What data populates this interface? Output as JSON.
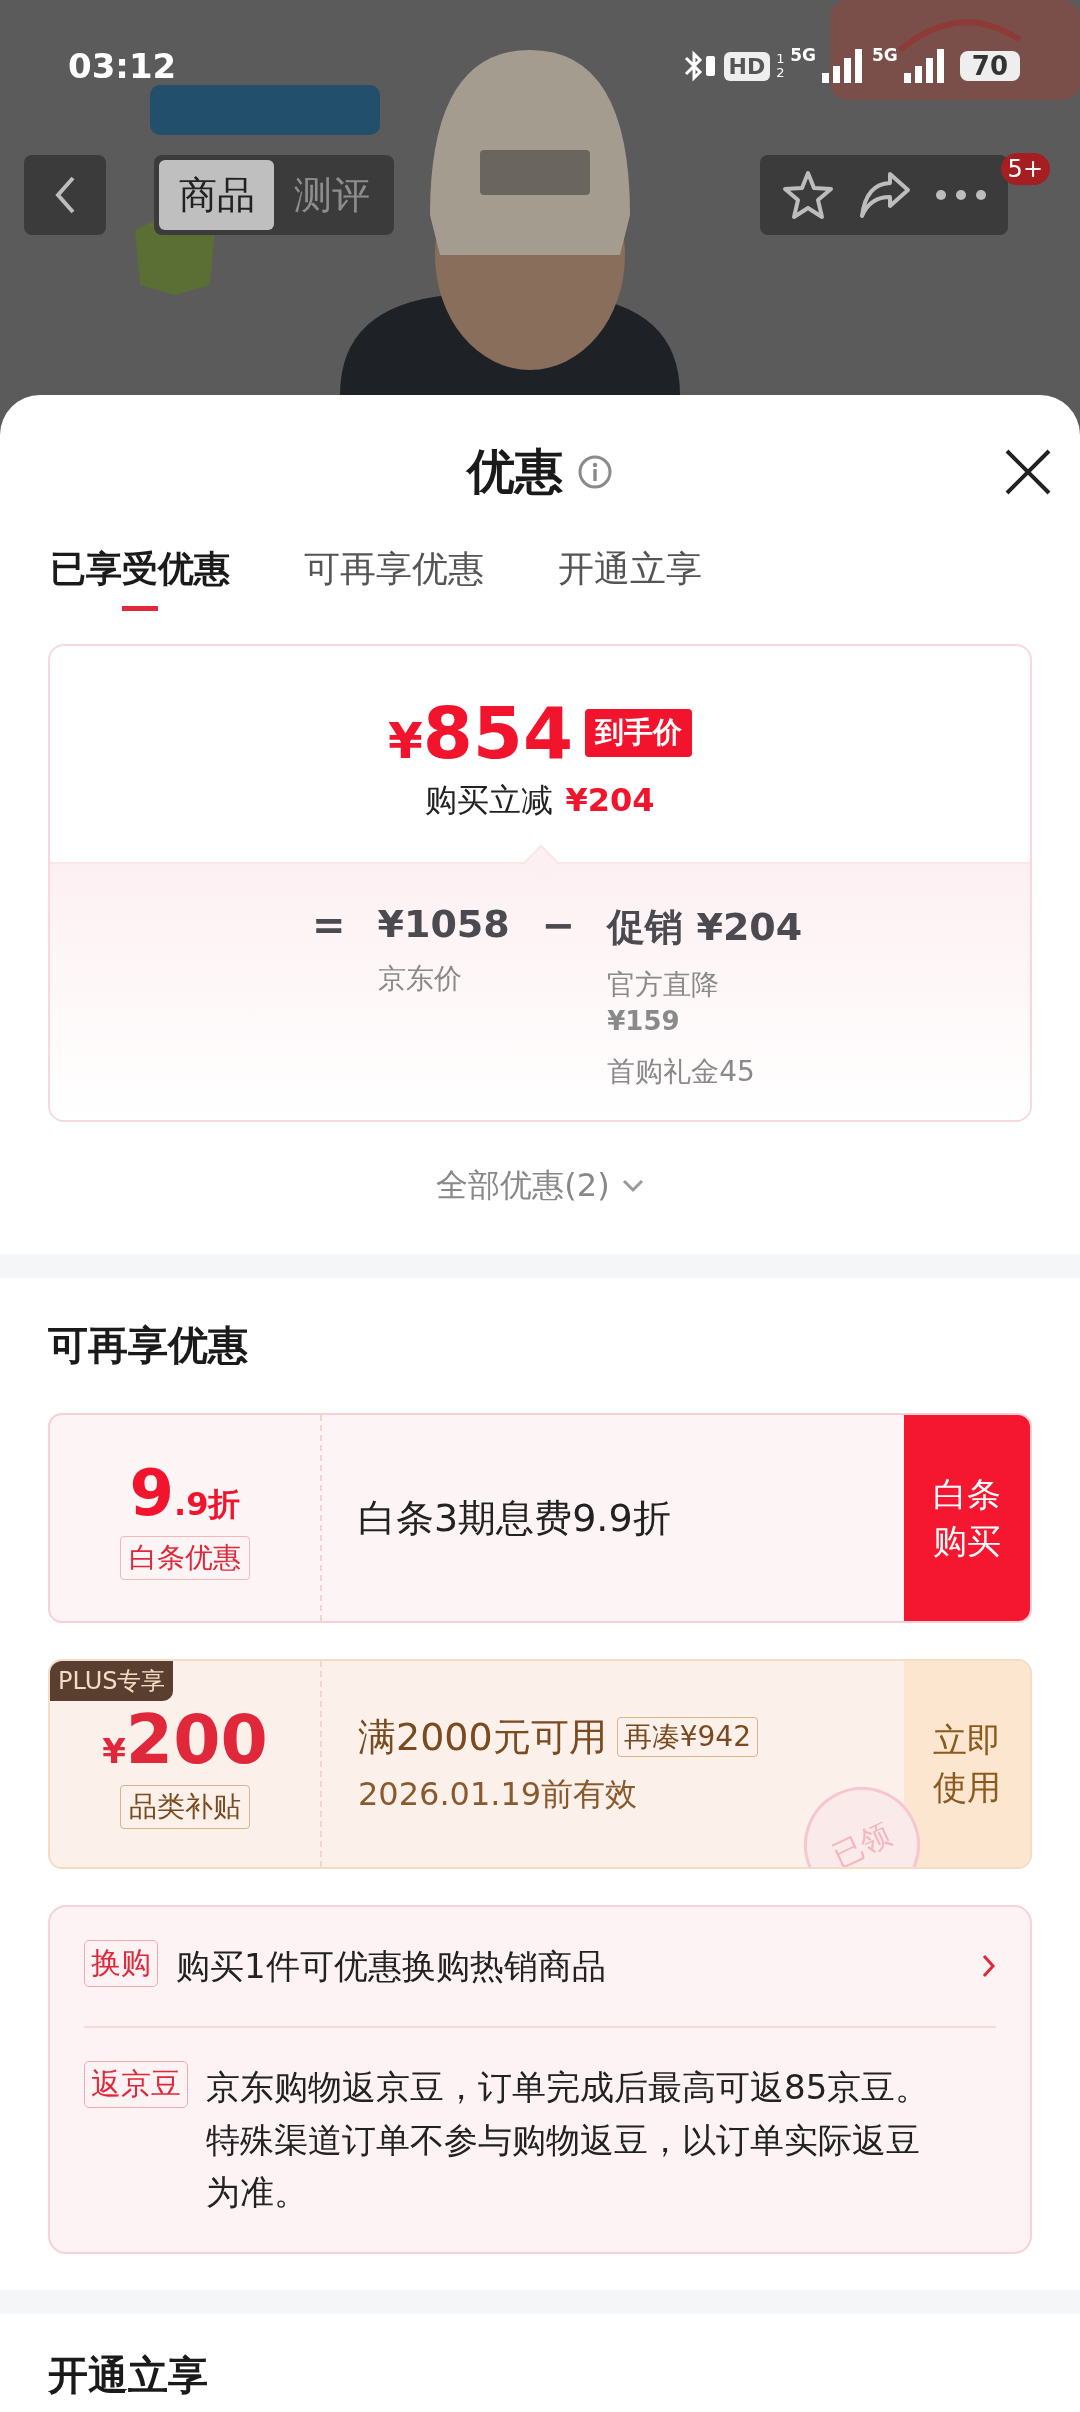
{
  "status_bar": {
    "time": "03:12",
    "hd": "HD",
    "hd_slots": "12",
    "networks": [
      "5G",
      "5G"
    ],
    "battery": "70"
  },
  "nav": {
    "tabs": [
      {
        "label": "商品",
        "selected": true
      },
      {
        "label": "测评",
        "selected": false
      }
    ],
    "badge": "5+"
  },
  "sheet": {
    "title": "优惠",
    "tabs": [
      {
        "label": "已享受优惠",
        "selected": true
      },
      {
        "label": "可再享优惠",
        "selected": false
      },
      {
        "label": "开通立享",
        "selected": false
      }
    ],
    "price_card": {
      "currency": "¥",
      "price": "854",
      "price_tag": "到手价",
      "saving_label": "购买立减",
      "saving": "¥204",
      "equals": "=",
      "base_price": "¥1058",
      "base_label": "京东价",
      "minus": "−",
      "promo_label": "促销",
      "promo_amount": "¥204",
      "promo_items": [
        {
          "label": "官方直降",
          "amount": "¥159"
        },
        {
          "label": "首购礼金45"
        }
      ]
    },
    "show_all": "全部优惠(2)",
    "more_section": {
      "title": "可再享优惠",
      "coupons": [
        {
          "kind": "discount",
          "value": "9",
          "value_suffix": ".9折",
          "tag": "白条优惠",
          "text": "白条3期息费9.9折",
          "action": "白条购买"
        },
        {
          "kind": "amount",
          "ribbon": "PLUS专享",
          "currency": "¥",
          "value": "200",
          "tag": "品类补贴",
          "text": "满2000元可用",
          "extra": "再凑¥942",
          "validity": "2026.01.19前有效",
          "action": "立即使用",
          "stamp": "已领"
        }
      ],
      "benefits": [
        {
          "tag": "换购",
          "text": "购买1件可优惠换购热销商品",
          "arrow": true
        },
        {
          "tag": "返京豆",
          "text": "京东购物返京豆，订单完成后最高可返85京豆。特殊渠道订单不参与购物返豆，以订单实际返豆为准。",
          "arrow": false
        }
      ]
    },
    "open_section": {
      "title": "开通立享"
    }
  }
}
